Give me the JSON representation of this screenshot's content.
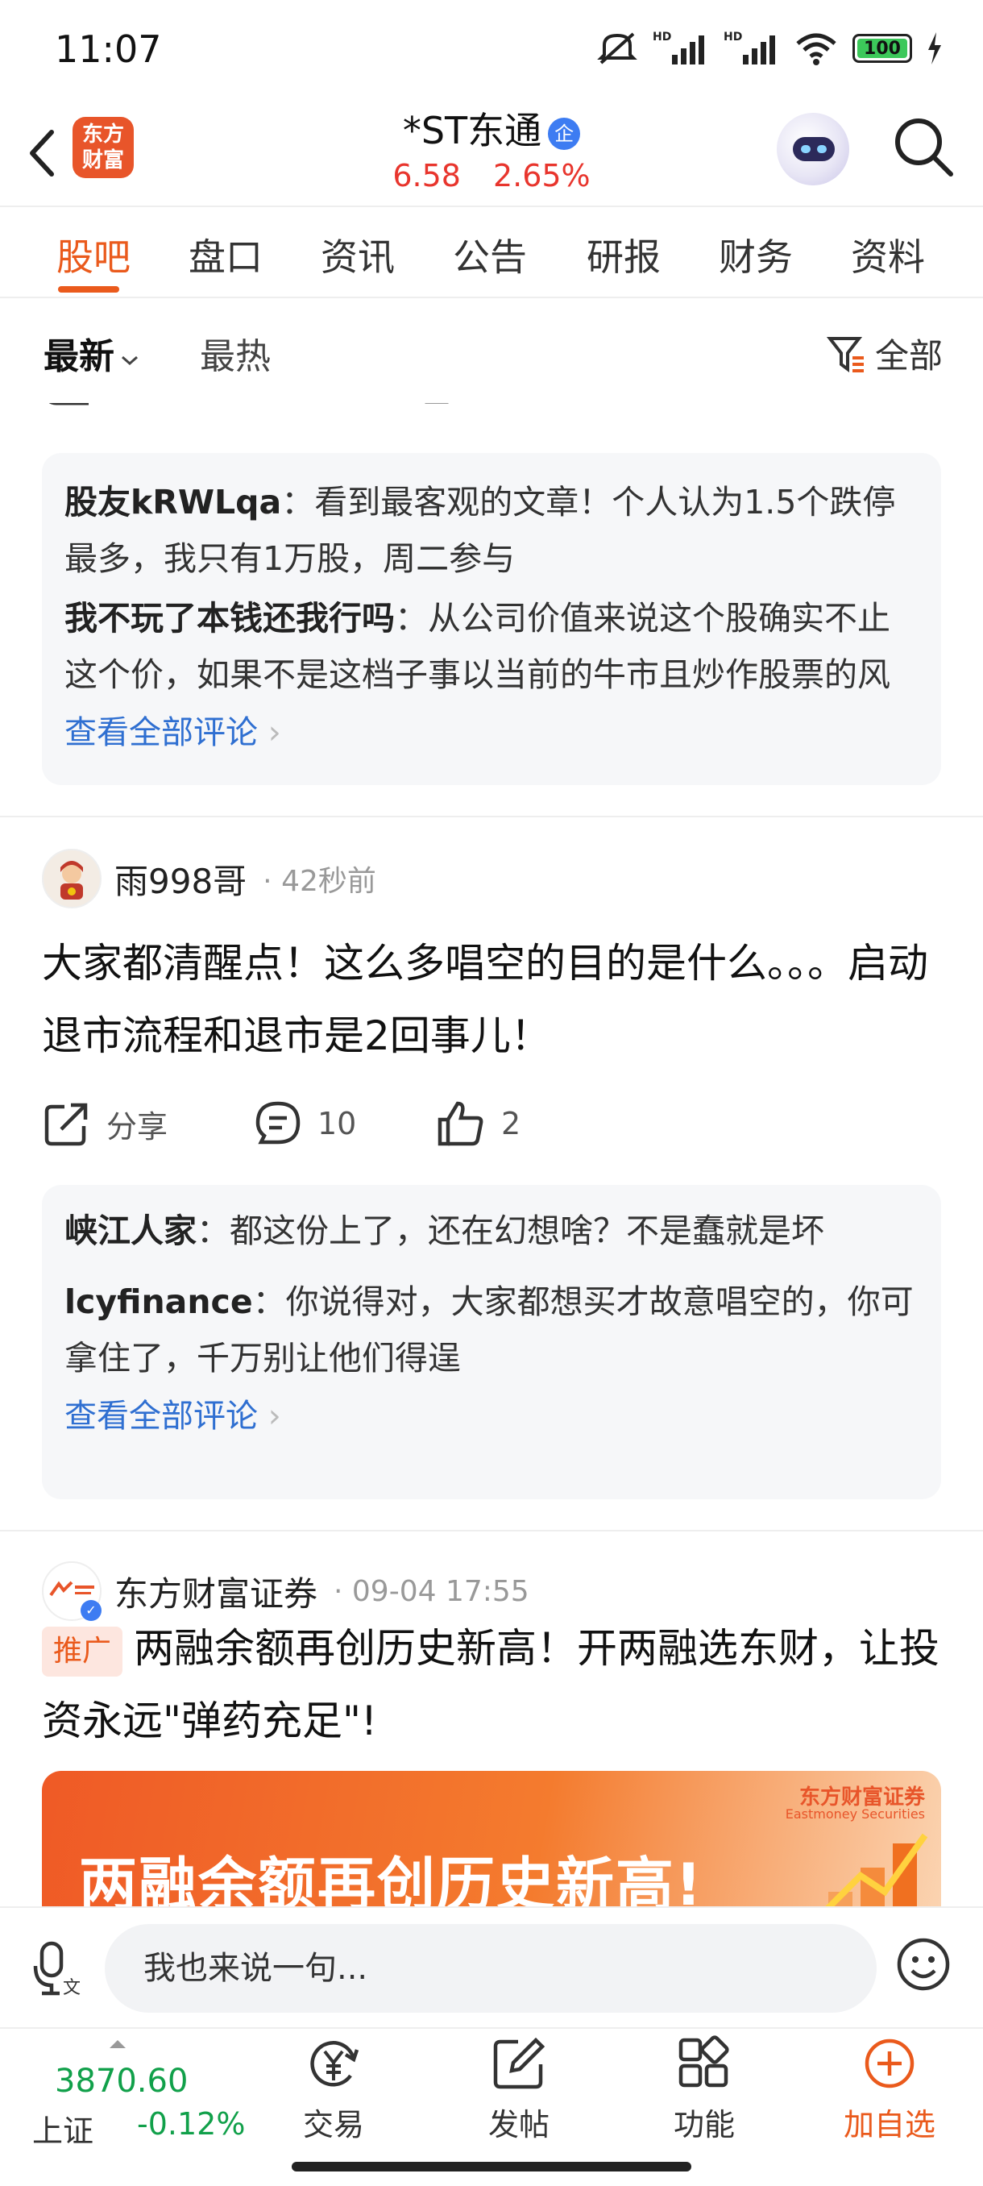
{
  "status_bar": {
    "time": "11:07",
    "battery": "100"
  },
  "header": {
    "logo_text": "东方财富",
    "stock_name": "*ST东通",
    "enterprise_badge": "企",
    "price": "6.58",
    "change_pct": "2.65%"
  },
  "tabs": [
    "股吧",
    "盘口",
    "资讯",
    "公告",
    "研报",
    "财务",
    "资料"
  ],
  "filter": {
    "latest": "最新",
    "hottest": "最热",
    "all": "全部"
  },
  "feed": {
    "comment_box_1": {
      "comments": [
        {
          "user": "股友kRWLqa",
          "text": "：看到最客观的文章！个人认为1.5个跌停最多，我只有1万股，周二参与"
        },
        {
          "user": "我不玩了本钱还我行吗",
          "text": "：从公司价值来说这个股确实不止这个价，如果不是这档子事以当前的牛市且炒作股票的风气"
        }
      ],
      "view_all": "查看全部评论"
    },
    "post_2": {
      "user": "雨998哥",
      "time": "42秒前",
      "body": "大家都清醒点！这么多唱空的目的是什么。。。启动退市流程和退市是2回事儿！",
      "share_label": "分享",
      "comment_count": "10",
      "like_count": "2",
      "comments": [
        {
          "user": "峡江人家",
          "text": "：都这份上了，还在幻想啥？不是蠢就是坏"
        },
        {
          "user": "lcyfinance",
          "text": "：你说得对，大家都想买才故意唱空的，你可拿住了，千万别让他们得逞"
        }
      ],
      "view_all": "查看全部评论"
    },
    "post_3": {
      "user": "东方财富证券",
      "time": "09-04 17:55",
      "promo_tag": "推广",
      "body": "两融余额再创历史新高！开两融选东财，让投资永远\"弹药充足\"!",
      "banner_text": "两融余额再创历史新高!",
      "banner_brand": "东方财富证券",
      "banner_sub": "Eastmoney Securities"
    }
  },
  "input_bar": {
    "placeholder": "我也来说一句..."
  },
  "bottom_bar": {
    "index_value": "3870.60",
    "index_name": "上证",
    "index_change": "-0.12%",
    "nav": [
      "交易",
      "发帖",
      "功能",
      "加自选"
    ]
  },
  "colors": {
    "accent": "#ea5a1c",
    "up": "#e8352d",
    "down": "#11a04a",
    "link": "#2f6fd1"
  }
}
